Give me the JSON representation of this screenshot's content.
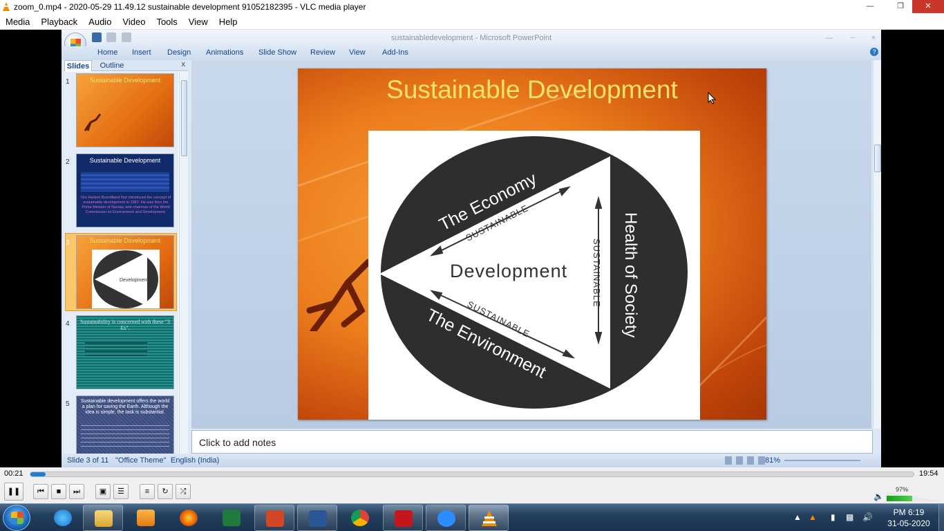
{
  "vlc": {
    "title": "zoom_0.mp4 - 2020-05-29 11.49.12 sustainable development 91052182395 - VLC media player",
    "menu": [
      "Media",
      "Playback",
      "Audio",
      "Video",
      "Tools",
      "View",
      "Help"
    ],
    "time_current": "00:21",
    "time_total": "19:54",
    "progress_fraction": 0.017,
    "volume_label": "97%",
    "volume_fraction": 0.97
  },
  "ppt": {
    "window_title": "sustainabledevelopment - Microsoft PowerPoint",
    "ribbon_tabs": [
      "Home",
      "Insert",
      "Design",
      "Animations",
      "Slide Show",
      "Review",
      "View",
      "Add-Ins"
    ],
    "pane_tabs": {
      "slides": "Slides",
      "outline": "Outline"
    },
    "pane_close": "x",
    "thumbnails": [
      {
        "num": "1",
        "title": "Sustainable Development",
        "body": ""
      },
      {
        "num": "2",
        "title": "Sustainable Development",
        "body": "Gro Harlem Brundtland first introduced the concept of sustainable development in 1987. He was then the Prime Minister of Norway and chairman of the World Commission on Environment and Development."
      },
      {
        "num": "3",
        "title": "Sustainable Development",
        "body": ""
      },
      {
        "num": "4",
        "title": "Sustainability is concerned with these \"3 Es\".",
        "body": ""
      },
      {
        "num": "5",
        "title": "Sustainable development offers the world a plan for saving the Earth. Although the idea is simple, the task is substantial.",
        "body": ""
      }
    ],
    "slide": {
      "title": "Sustainable Development",
      "diagram": {
        "center": "Development",
        "top": "The Economy",
        "right": "Health of Society",
        "bottom": "The Environment",
        "arrow_label": "SUSTAINABLE"
      }
    },
    "notes_placeholder": "Click to add notes",
    "status": {
      "slide_count": "Slide 3 of 11",
      "theme": "\"Office Theme\"",
      "language": "English (India)",
      "zoom": "81%"
    }
  },
  "taskbar": {
    "time": "PM 6:19",
    "date": "31-05-2020"
  }
}
